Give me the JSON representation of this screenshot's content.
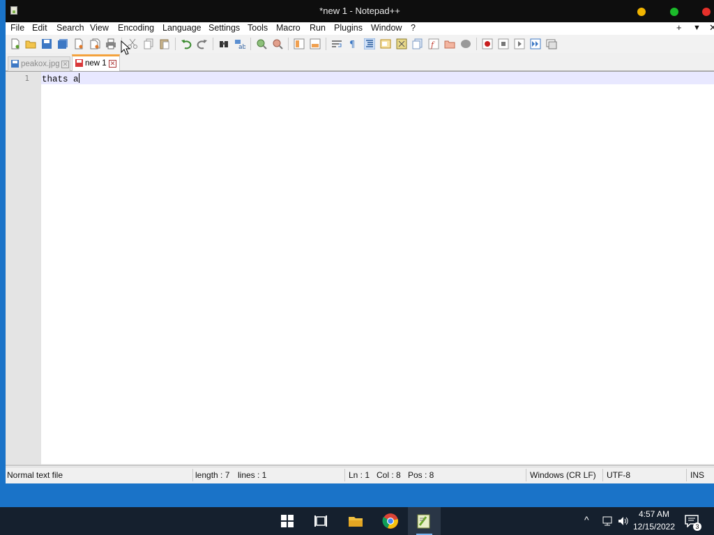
{
  "window": {
    "title": "*new 1 - Notepad++"
  },
  "menubar": {
    "items": [
      "File",
      "Edit",
      "Search",
      "View",
      "Encoding",
      "Language",
      "Settings",
      "Tools",
      "Macro",
      "Run",
      "Plugins",
      "Window",
      "?"
    ],
    "right": [
      "+",
      "▼",
      "✕"
    ]
  },
  "tabs": [
    {
      "label": "peakox.jpg",
      "active": false,
      "icon": "saved-file-icon"
    },
    {
      "label": "new 1",
      "active": true,
      "icon": "unsaved-file-icon"
    }
  ],
  "editor": {
    "line_number": "1",
    "text": "thats a"
  },
  "statusbar": {
    "file_type": "Normal text file",
    "length": "length : 7",
    "lines": "lines : 1",
    "ln": "Ln : 1",
    "col": "Col : 8",
    "pos": "Pos : 8",
    "eol": "Windows (CR LF)",
    "encoding": "UTF-8",
    "mode": "INS"
  },
  "taskbar": {
    "time": "4:57 AM",
    "date": "12/15/2022",
    "notifications": "3",
    "apps": [
      "start-icon",
      "task-view-icon",
      "file-explorer-icon",
      "chrome-icon",
      "notepad-plus-plus-icon"
    ]
  },
  "colors": {
    "titlebar": "#0e0e0e",
    "desktop": "#1a73c8",
    "taskbar": "#15202e",
    "current_line": "#e8e8ff",
    "active_tab_accent": "#f4a23c"
  }
}
